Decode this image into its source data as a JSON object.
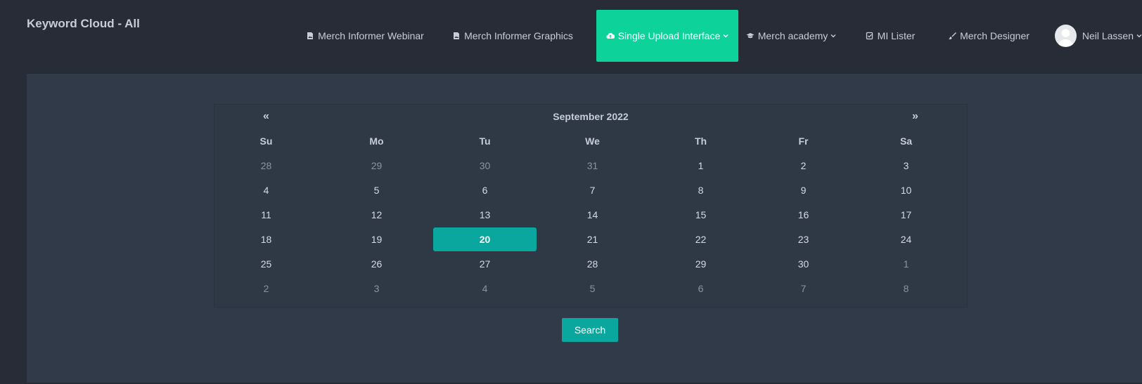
{
  "header": {
    "title": "Keyword Cloud - All"
  },
  "nav": {
    "items": [
      {
        "label": "Merch Informer Webinar",
        "icon": "file-image-icon"
      },
      {
        "label": "Merch Informer Graphics",
        "icon": "file-image-icon"
      },
      {
        "label": "Single Upload Interface",
        "icon": "cloud-upload-icon",
        "active": true,
        "dropdown": true
      },
      {
        "label": "Merch academy",
        "icon": "graduation-cap-icon",
        "dropdown": true
      },
      {
        "label": "MI Lister",
        "icon": "checklist-icon"
      },
      {
        "label": "Merch Designer",
        "icon": "paint-brush-icon"
      }
    ],
    "user": {
      "name": "Neil Lassen"
    }
  },
  "calendar": {
    "prev": "«",
    "next": "»",
    "month": "September 2022",
    "weekdays": [
      "Su",
      "Mo",
      "Tu",
      "We",
      "Th",
      "Fr",
      "Sa"
    ],
    "weeks": [
      [
        "28",
        "29",
        "30",
        "31",
        "1",
        "2",
        "3"
      ],
      [
        "4",
        "5",
        "6",
        "7",
        "8",
        "9",
        "10"
      ],
      [
        "11",
        "12",
        "13",
        "14",
        "15",
        "16",
        "17"
      ],
      [
        "18",
        "19",
        "20",
        "21",
        "22",
        "23",
        "24"
      ],
      [
        "25",
        "26",
        "27",
        "28",
        "29",
        "30",
        "1"
      ],
      [
        "2",
        "3",
        "4",
        "5",
        "6",
        "7",
        "8"
      ]
    ],
    "selected": "20"
  },
  "search_label": "Search",
  "colors": {
    "accent": "#0dd39b",
    "selected": "#0aa79f",
    "background": "#282c37",
    "panel": "#313a48"
  }
}
